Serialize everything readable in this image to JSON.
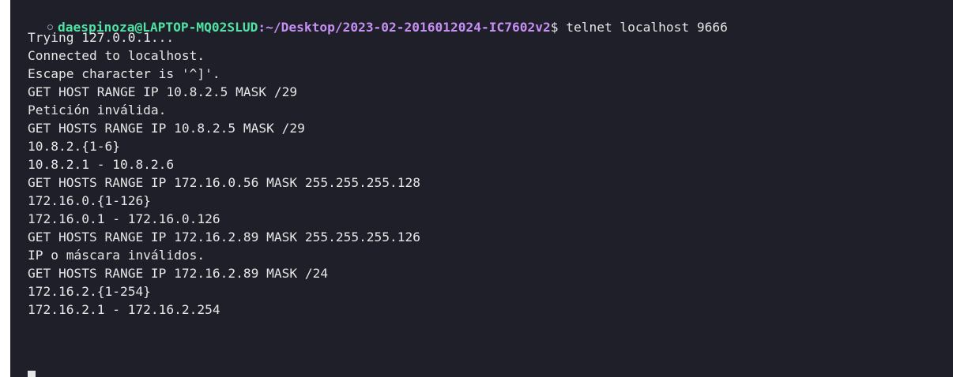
{
  "terminal": {
    "prompt": {
      "user_host": "daespinoza@LAPTOP-MQ02SLUD",
      "path": ":~/Desktop/2023-02-2016012024-IC7602v2",
      "dollar": "$",
      "command": " telnet localhost 9666"
    },
    "output": [
      "Trying 127.0.0.1...",
      "Connected to localhost.",
      "Escape character is '^]'.",
      "GET HOST RANGE IP 10.8.2.5 MASK /29",
      "Petición inválida.",
      "GET HOSTS RANGE IP 10.8.2.5 MASK /29",
      "10.8.2.{1-6}",
      "10.8.2.1 - 10.8.2.6",
      "GET HOSTS RANGE IP 172.16.0.56 MASK 255.255.255.128",
      "172.16.0.{1-126}",
      "172.16.0.1 - 172.16.0.126",
      "GET HOSTS RANGE IP 172.16.2.89 MASK 255.255.255.126",
      "IP o máscara inválidos.",
      "GET HOSTS RANGE IP 172.16.2.89 MASK /24",
      "172.16.2.{1-254}",
      "172.16.2.1 - 172.16.2.254"
    ],
    "colors": {
      "background": "#1e1f29",
      "user_host": "#50e3a4",
      "path": "#c68ff3",
      "text": "#e6e6e6"
    }
  }
}
